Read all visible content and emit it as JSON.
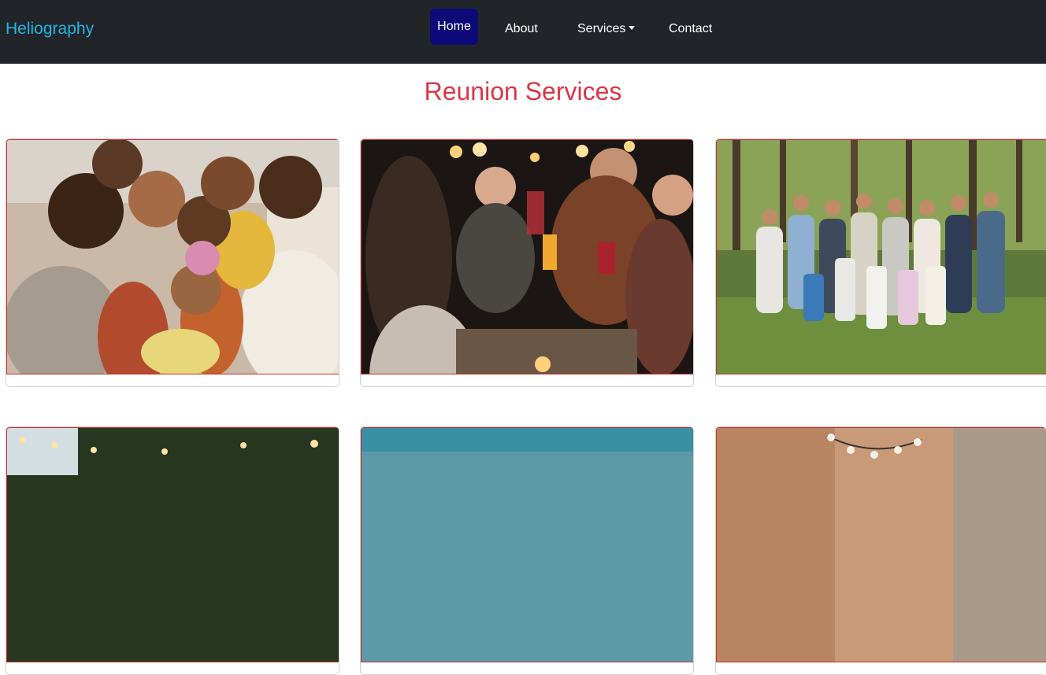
{
  "navbar": {
    "brand": "Heliography",
    "items": [
      {
        "label": "Home",
        "active": true
      },
      {
        "label": "About"
      },
      {
        "label": "Services",
        "dropdown": true
      },
      {
        "label": "Contact"
      }
    ]
  },
  "page": {
    "title": "Reunion Services"
  },
  "cards": [
    {
      "image": "family-group-hug-photo"
    },
    {
      "image": "evening-dinner-toast-photo"
    },
    {
      "image": "extended-family-outdoor-portrait-photo"
    },
    {
      "image": "string-lights-trees-photo"
    },
    {
      "image": "sky-landscape-photo"
    },
    {
      "image": "brick-wall-string-lights-photo"
    }
  ],
  "colors": {
    "navbar_bg": "#212529",
    "brand": "#1fb6e6",
    "active_nav_bg": "#0c0a78",
    "title": "#dc3545",
    "image_border": "#cf2a2a"
  }
}
